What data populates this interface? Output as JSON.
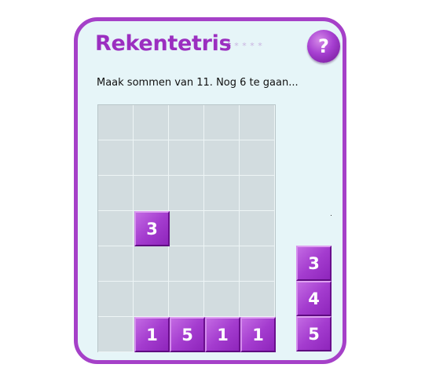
{
  "app": {
    "title": "Rekentetris",
    "difficulty": {
      "filled": 1,
      "total": 5,
      "filled_color": "#9b2fc0",
      "empty_color": "#c9b3e0"
    },
    "help_label": "?"
  },
  "instruction": "Maak sommen van 11. Nog 6 te gaan...",
  "board": {
    "columns": 5,
    "rows": 7,
    "falling_tile": {
      "value": "3",
      "col": 1,
      "row": 3
    },
    "placed_tiles": [
      {
        "value": "1",
        "col": 1,
        "row": 6
      },
      {
        "value": "5",
        "col": 2,
        "row": 6
      },
      {
        "value": "1",
        "col": 3,
        "row": 6
      },
      {
        "value": "1",
        "col": 4,
        "row": 6
      }
    ]
  },
  "next_tiles": [
    "3",
    "4",
    "5"
  ],
  "colors": {
    "accent": "#a540c8",
    "panel": "#e6f5f8",
    "grid": "#d2dcdf"
  }
}
